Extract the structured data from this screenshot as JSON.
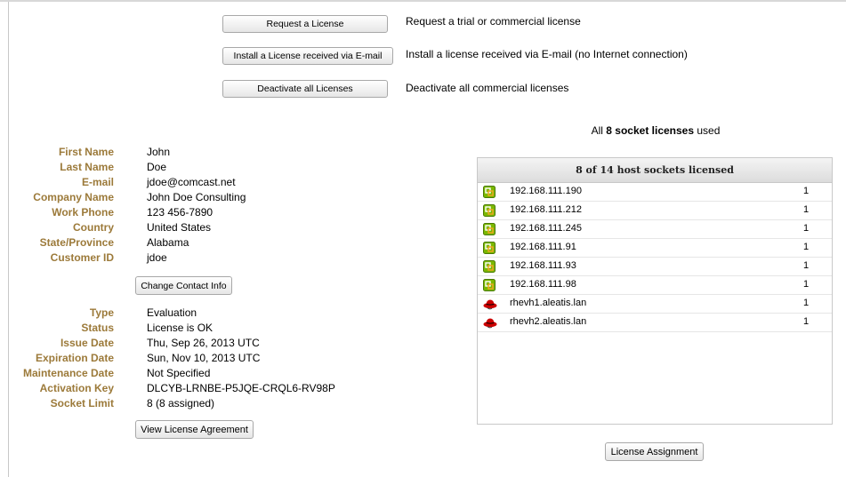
{
  "actions": [
    {
      "button": "Request a License",
      "description": "Request a trial or commercial license"
    },
    {
      "button": "Install a License received via E-mail",
      "description": "Install a license received via E-mail (no Internet connection)"
    },
    {
      "button": "Deactivate all Licenses",
      "description": "Deactivate all commercial licenses"
    }
  ],
  "contact": {
    "fields": [
      {
        "label": "First Name",
        "value": "John"
      },
      {
        "label": "Last Name",
        "value": "Doe"
      },
      {
        "label": "E-mail",
        "value": "jdoe@comcast.net"
      },
      {
        "label": "Company Name",
        "value": "John Doe Consulting"
      },
      {
        "label": "Work Phone",
        "value": "123 456-7890"
      },
      {
        "label": "Country",
        "value": "United States"
      },
      {
        "label": "State/Province",
        "value": "Alabama"
      },
      {
        "label": "Customer ID",
        "value": "jdoe"
      }
    ],
    "change_button": "Change Contact Info"
  },
  "license": {
    "fields": [
      {
        "label": "Type",
        "value": "Evaluation"
      },
      {
        "label": "Status",
        "value": "License is OK"
      },
      {
        "label": "Issue Date",
        "value": "Thu, Sep 26, 2013 UTC"
      },
      {
        "label": "Expiration Date",
        "value": "Sun, Nov 10, 2013 UTC"
      },
      {
        "label": "Maintenance Date",
        "value": "Not Specified"
      },
      {
        "label": "Activation Key",
        "value": "DLCYB-LRNBE-P5JQE-CRQL6-RV98P"
      },
      {
        "label": "Socket Limit",
        "value": "8 (8 assigned)"
      }
    ],
    "agreement_button": "View License Agreement"
  },
  "summary": {
    "prefix": "All ",
    "bold": "8 socket licenses",
    "suffix": " used"
  },
  "hosts": {
    "header": "8 of 14 host sockets licensed",
    "items": [
      {
        "name": "192.168.111.190",
        "count": "1",
        "icon": "vmware-host-icon"
      },
      {
        "name": "192.168.111.212",
        "count": "1",
        "icon": "vmware-host-icon"
      },
      {
        "name": "192.168.111.245",
        "count": "1",
        "icon": "vmware-host-icon"
      },
      {
        "name": "192.168.111.91",
        "count": "1",
        "icon": "vmware-host-icon"
      },
      {
        "name": "192.168.111.93",
        "count": "1",
        "icon": "vmware-host-icon"
      },
      {
        "name": "192.168.111.98",
        "count": "1",
        "icon": "vmware-host-icon"
      },
      {
        "name": "rhevh1.aleatis.lan",
        "count": "1",
        "icon": "redhat-host-icon"
      },
      {
        "name": "rhevh2.aleatis.lan",
        "count": "1",
        "icon": "redhat-host-icon"
      }
    ],
    "assignment_button": "License Assignment"
  },
  "colors": {
    "label": "#9c7a3a",
    "vmware_green": "#7ab800",
    "vmware_orange": "#f5a623",
    "redhat_red": "#cc0000"
  }
}
